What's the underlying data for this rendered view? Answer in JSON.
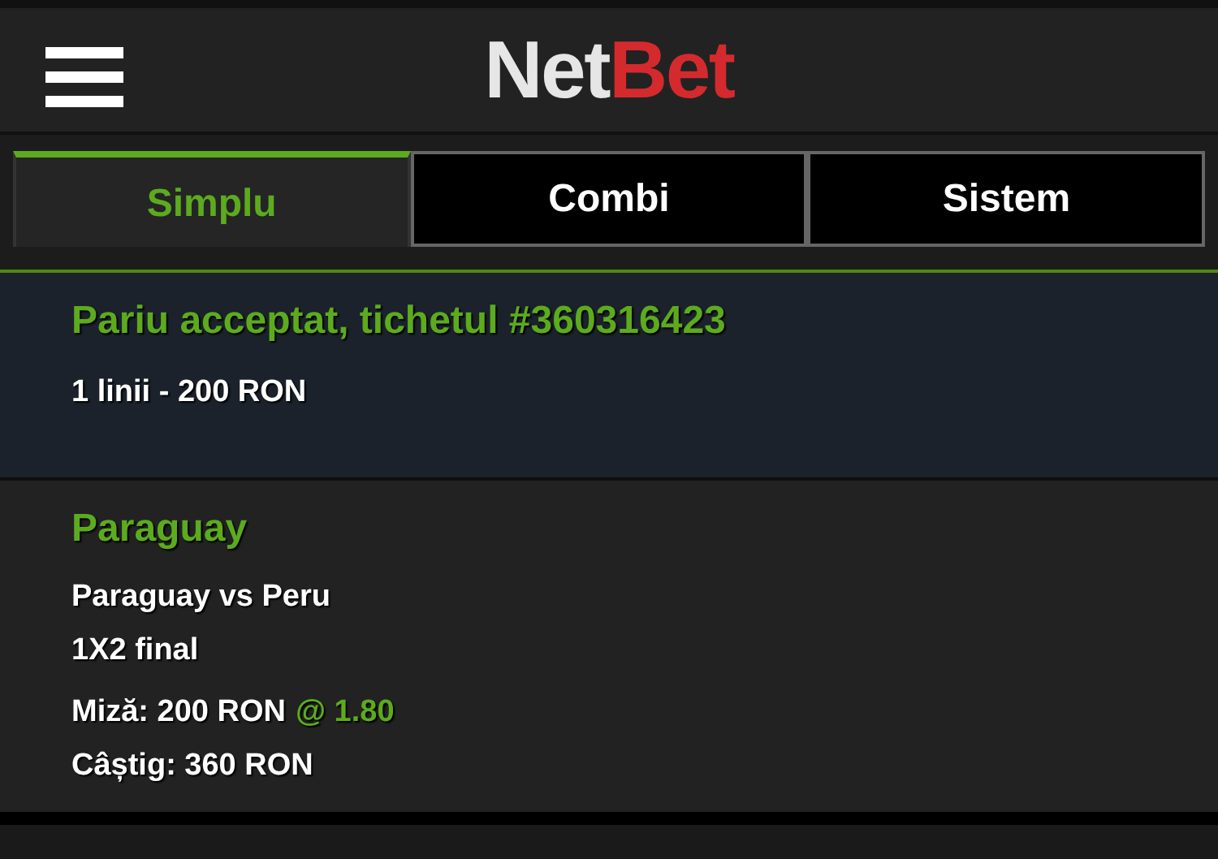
{
  "header": {
    "logo": {
      "first": "Net",
      "second": "Bet"
    }
  },
  "tabs": [
    {
      "label": "Simplu",
      "selected": true
    },
    {
      "label": "Combi",
      "selected": false
    },
    {
      "label": "Sistem",
      "selected": false
    }
  ],
  "confirmation": {
    "title": "Pariu acceptat, tichetul #360316423",
    "summary": "1 linii - 200 RON"
  },
  "bet": {
    "selection": "Paraguay",
    "match": "Paraguay vs Peru",
    "market": "1X2 final",
    "stake": "Miză: 200 RON",
    "odds": "@ 1.80",
    "winnings": "Câștig: 360 RON"
  }
}
